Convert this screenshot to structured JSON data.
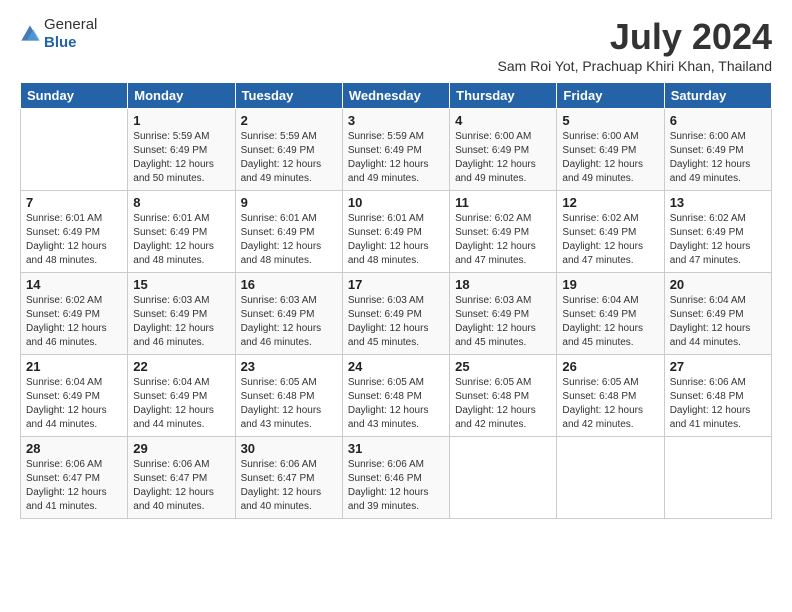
{
  "header": {
    "logo": {
      "general": "General",
      "blue": "Blue"
    },
    "title": "July 2024",
    "subtitle": "Sam Roi Yot, Prachuap Khiri Khan, Thailand"
  },
  "days_of_week": [
    "Sunday",
    "Monday",
    "Tuesday",
    "Wednesday",
    "Thursday",
    "Friday",
    "Saturday"
  ],
  "weeks": [
    [
      {
        "day": "",
        "sunrise": "",
        "sunset": "",
        "daylight": ""
      },
      {
        "day": "1",
        "sunrise": "Sunrise: 5:59 AM",
        "sunset": "Sunset: 6:49 PM",
        "daylight": "Daylight: 12 hours and 50 minutes."
      },
      {
        "day": "2",
        "sunrise": "Sunrise: 5:59 AM",
        "sunset": "Sunset: 6:49 PM",
        "daylight": "Daylight: 12 hours and 49 minutes."
      },
      {
        "day": "3",
        "sunrise": "Sunrise: 5:59 AM",
        "sunset": "Sunset: 6:49 PM",
        "daylight": "Daylight: 12 hours and 49 minutes."
      },
      {
        "day": "4",
        "sunrise": "Sunrise: 6:00 AM",
        "sunset": "Sunset: 6:49 PM",
        "daylight": "Daylight: 12 hours and 49 minutes."
      },
      {
        "day": "5",
        "sunrise": "Sunrise: 6:00 AM",
        "sunset": "Sunset: 6:49 PM",
        "daylight": "Daylight: 12 hours and 49 minutes."
      },
      {
        "day": "6",
        "sunrise": "Sunrise: 6:00 AM",
        "sunset": "Sunset: 6:49 PM",
        "daylight": "Daylight: 12 hours and 49 minutes."
      }
    ],
    [
      {
        "day": "7",
        "sunrise": "Sunrise: 6:01 AM",
        "sunset": "Sunset: 6:49 PM",
        "daylight": "Daylight: 12 hours and 48 minutes."
      },
      {
        "day": "8",
        "sunrise": "Sunrise: 6:01 AM",
        "sunset": "Sunset: 6:49 PM",
        "daylight": "Daylight: 12 hours and 48 minutes."
      },
      {
        "day": "9",
        "sunrise": "Sunrise: 6:01 AM",
        "sunset": "Sunset: 6:49 PM",
        "daylight": "Daylight: 12 hours and 48 minutes."
      },
      {
        "day": "10",
        "sunrise": "Sunrise: 6:01 AM",
        "sunset": "Sunset: 6:49 PM",
        "daylight": "Daylight: 12 hours and 48 minutes."
      },
      {
        "day": "11",
        "sunrise": "Sunrise: 6:02 AM",
        "sunset": "Sunset: 6:49 PM",
        "daylight": "Daylight: 12 hours and 47 minutes."
      },
      {
        "day": "12",
        "sunrise": "Sunrise: 6:02 AM",
        "sunset": "Sunset: 6:49 PM",
        "daylight": "Daylight: 12 hours and 47 minutes."
      },
      {
        "day": "13",
        "sunrise": "Sunrise: 6:02 AM",
        "sunset": "Sunset: 6:49 PM",
        "daylight": "Daylight: 12 hours and 47 minutes."
      }
    ],
    [
      {
        "day": "14",
        "sunrise": "Sunrise: 6:02 AM",
        "sunset": "Sunset: 6:49 PM",
        "daylight": "Daylight: 12 hours and 46 minutes."
      },
      {
        "day": "15",
        "sunrise": "Sunrise: 6:03 AM",
        "sunset": "Sunset: 6:49 PM",
        "daylight": "Daylight: 12 hours and 46 minutes."
      },
      {
        "day": "16",
        "sunrise": "Sunrise: 6:03 AM",
        "sunset": "Sunset: 6:49 PM",
        "daylight": "Daylight: 12 hours and 46 minutes."
      },
      {
        "day": "17",
        "sunrise": "Sunrise: 6:03 AM",
        "sunset": "Sunset: 6:49 PM",
        "daylight": "Daylight: 12 hours and 45 minutes."
      },
      {
        "day": "18",
        "sunrise": "Sunrise: 6:03 AM",
        "sunset": "Sunset: 6:49 PM",
        "daylight": "Daylight: 12 hours and 45 minutes."
      },
      {
        "day": "19",
        "sunrise": "Sunrise: 6:04 AM",
        "sunset": "Sunset: 6:49 PM",
        "daylight": "Daylight: 12 hours and 45 minutes."
      },
      {
        "day": "20",
        "sunrise": "Sunrise: 6:04 AM",
        "sunset": "Sunset: 6:49 PM",
        "daylight": "Daylight: 12 hours and 44 minutes."
      }
    ],
    [
      {
        "day": "21",
        "sunrise": "Sunrise: 6:04 AM",
        "sunset": "Sunset: 6:49 PM",
        "daylight": "Daylight: 12 hours and 44 minutes."
      },
      {
        "day": "22",
        "sunrise": "Sunrise: 6:04 AM",
        "sunset": "Sunset: 6:49 PM",
        "daylight": "Daylight: 12 hours and 44 minutes."
      },
      {
        "day": "23",
        "sunrise": "Sunrise: 6:05 AM",
        "sunset": "Sunset: 6:48 PM",
        "daylight": "Daylight: 12 hours and 43 minutes."
      },
      {
        "day": "24",
        "sunrise": "Sunrise: 6:05 AM",
        "sunset": "Sunset: 6:48 PM",
        "daylight": "Daylight: 12 hours and 43 minutes."
      },
      {
        "day": "25",
        "sunrise": "Sunrise: 6:05 AM",
        "sunset": "Sunset: 6:48 PM",
        "daylight": "Daylight: 12 hours and 42 minutes."
      },
      {
        "day": "26",
        "sunrise": "Sunrise: 6:05 AM",
        "sunset": "Sunset: 6:48 PM",
        "daylight": "Daylight: 12 hours and 42 minutes."
      },
      {
        "day": "27",
        "sunrise": "Sunrise: 6:06 AM",
        "sunset": "Sunset: 6:48 PM",
        "daylight": "Daylight: 12 hours and 41 minutes."
      }
    ],
    [
      {
        "day": "28",
        "sunrise": "Sunrise: 6:06 AM",
        "sunset": "Sunset: 6:47 PM",
        "daylight": "Daylight: 12 hours and 41 minutes."
      },
      {
        "day": "29",
        "sunrise": "Sunrise: 6:06 AM",
        "sunset": "Sunset: 6:47 PM",
        "daylight": "Daylight: 12 hours and 40 minutes."
      },
      {
        "day": "30",
        "sunrise": "Sunrise: 6:06 AM",
        "sunset": "Sunset: 6:47 PM",
        "daylight": "Daylight: 12 hours and 40 minutes."
      },
      {
        "day": "31",
        "sunrise": "Sunrise: 6:06 AM",
        "sunset": "Sunset: 6:46 PM",
        "daylight": "Daylight: 12 hours and 39 minutes."
      },
      {
        "day": "",
        "sunrise": "",
        "sunset": "",
        "daylight": ""
      },
      {
        "day": "",
        "sunrise": "",
        "sunset": "",
        "daylight": ""
      },
      {
        "day": "",
        "sunrise": "",
        "sunset": "",
        "daylight": ""
      }
    ]
  ]
}
